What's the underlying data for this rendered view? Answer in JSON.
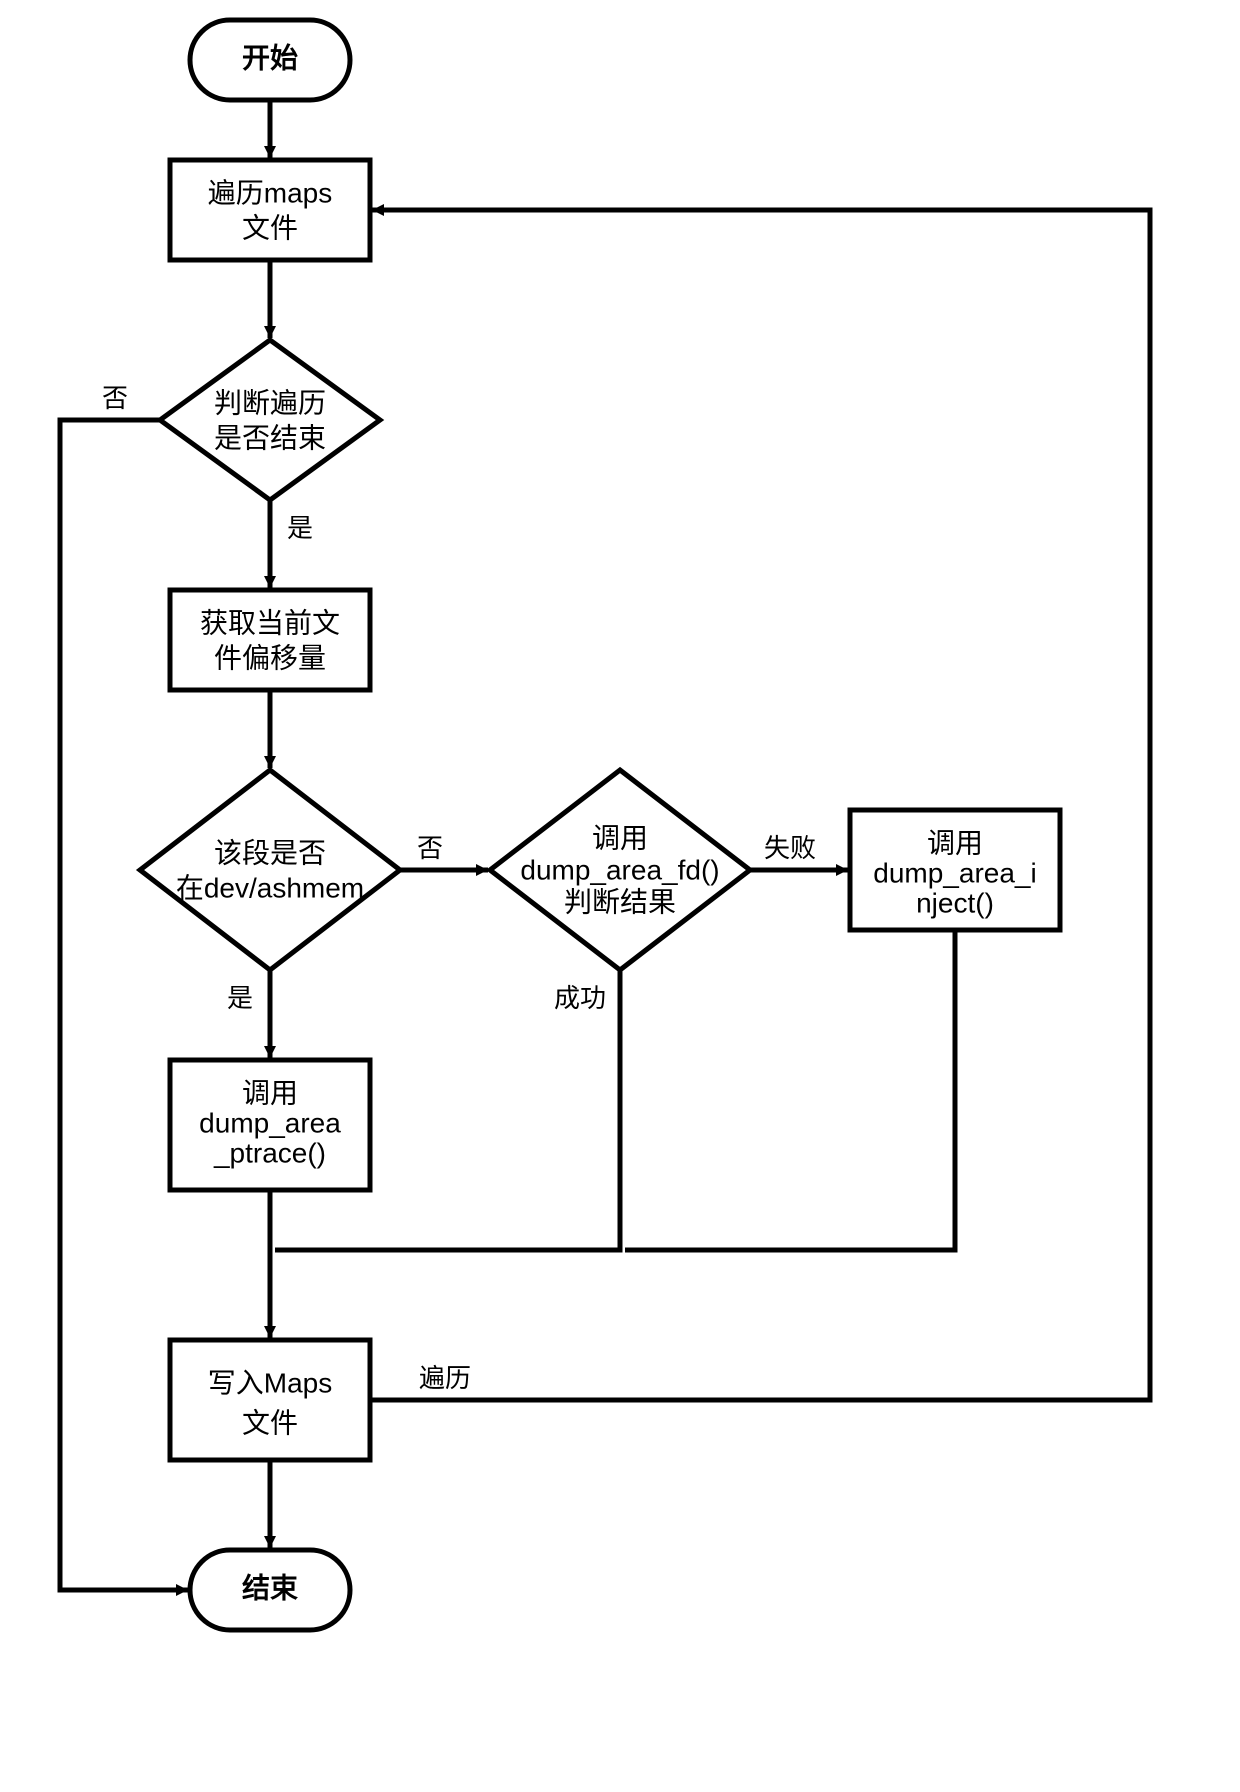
{
  "chart_data": {
    "type": "flowchart",
    "nodes": [
      {
        "id": "start",
        "type": "terminal",
        "label": "开始"
      },
      {
        "id": "traverse",
        "type": "process",
        "label": "遍历maps\n文件"
      },
      {
        "id": "check_end",
        "type": "decision",
        "label": "判断遍历\n是否结束"
      },
      {
        "id": "get_offset",
        "type": "process",
        "label": "获取当前文\n件偏移量"
      },
      {
        "id": "check_ashmem",
        "type": "decision",
        "label": "该段是否\n在dev/ashmem"
      },
      {
        "id": "dump_fd",
        "type": "decision",
        "label": "调用\ndump_area_fd()\n判断结果"
      },
      {
        "id": "dump_inject",
        "type": "process",
        "label": "调用\ndump_area_i\nnject()"
      },
      {
        "id": "dump_ptrace",
        "type": "process",
        "label": "调用\ndump_area\n_ptrace()"
      },
      {
        "id": "write_maps",
        "type": "process",
        "label": "写入Maps\n文件"
      },
      {
        "id": "end",
        "type": "terminal",
        "label": "结束"
      }
    ],
    "edges": [
      {
        "from": "start",
        "to": "traverse"
      },
      {
        "from": "traverse",
        "to": "check_end"
      },
      {
        "from": "check_end",
        "to": "get_offset",
        "label": "是"
      },
      {
        "from": "check_end",
        "to": "end",
        "label": "否"
      },
      {
        "from": "get_offset",
        "to": "check_ashmem"
      },
      {
        "from": "check_ashmem",
        "to": "dump_ptrace",
        "label": "是"
      },
      {
        "from": "check_ashmem",
        "to": "dump_fd",
        "label": "否"
      },
      {
        "from": "dump_fd",
        "to": "dump_inject",
        "label": "失败"
      },
      {
        "from": "dump_fd",
        "to": "merge",
        "label": "成功"
      },
      {
        "from": "dump_ptrace",
        "to": "write_maps"
      },
      {
        "from": "dump_inject",
        "to": "merge"
      },
      {
        "from": "write_maps",
        "to": "traverse",
        "label": "遍历"
      },
      {
        "from": "write_maps",
        "to": "end"
      }
    ]
  },
  "labels": {
    "start": "开始",
    "traverse_l1": "遍历maps",
    "traverse_l2": "文件",
    "check_end_l1": "判断遍历",
    "check_end_l2": "是否结束",
    "get_offset_l1": "获取当前文",
    "get_offset_l2": "件偏移量",
    "check_ashmem_l1": "该段是否",
    "check_ashmem_l2": "在dev/ashmem",
    "dump_fd_l1": "调用",
    "dump_fd_l2": "dump_area_fd()",
    "dump_fd_l3": "判断结果",
    "dump_inject_l1": "调用",
    "dump_inject_l2": "dump_area_i",
    "dump_inject_l3": "nject()",
    "dump_ptrace_l1": "调用",
    "dump_ptrace_l2": "dump_area",
    "dump_ptrace_l3": "_ptrace()",
    "write_maps_l1": "写入Maps",
    "write_maps_l2": "文件",
    "end": "结束",
    "edge_yes": "是",
    "edge_no": "否",
    "edge_fail": "失败",
    "edge_success": "成功",
    "edge_loop": "遍历"
  }
}
